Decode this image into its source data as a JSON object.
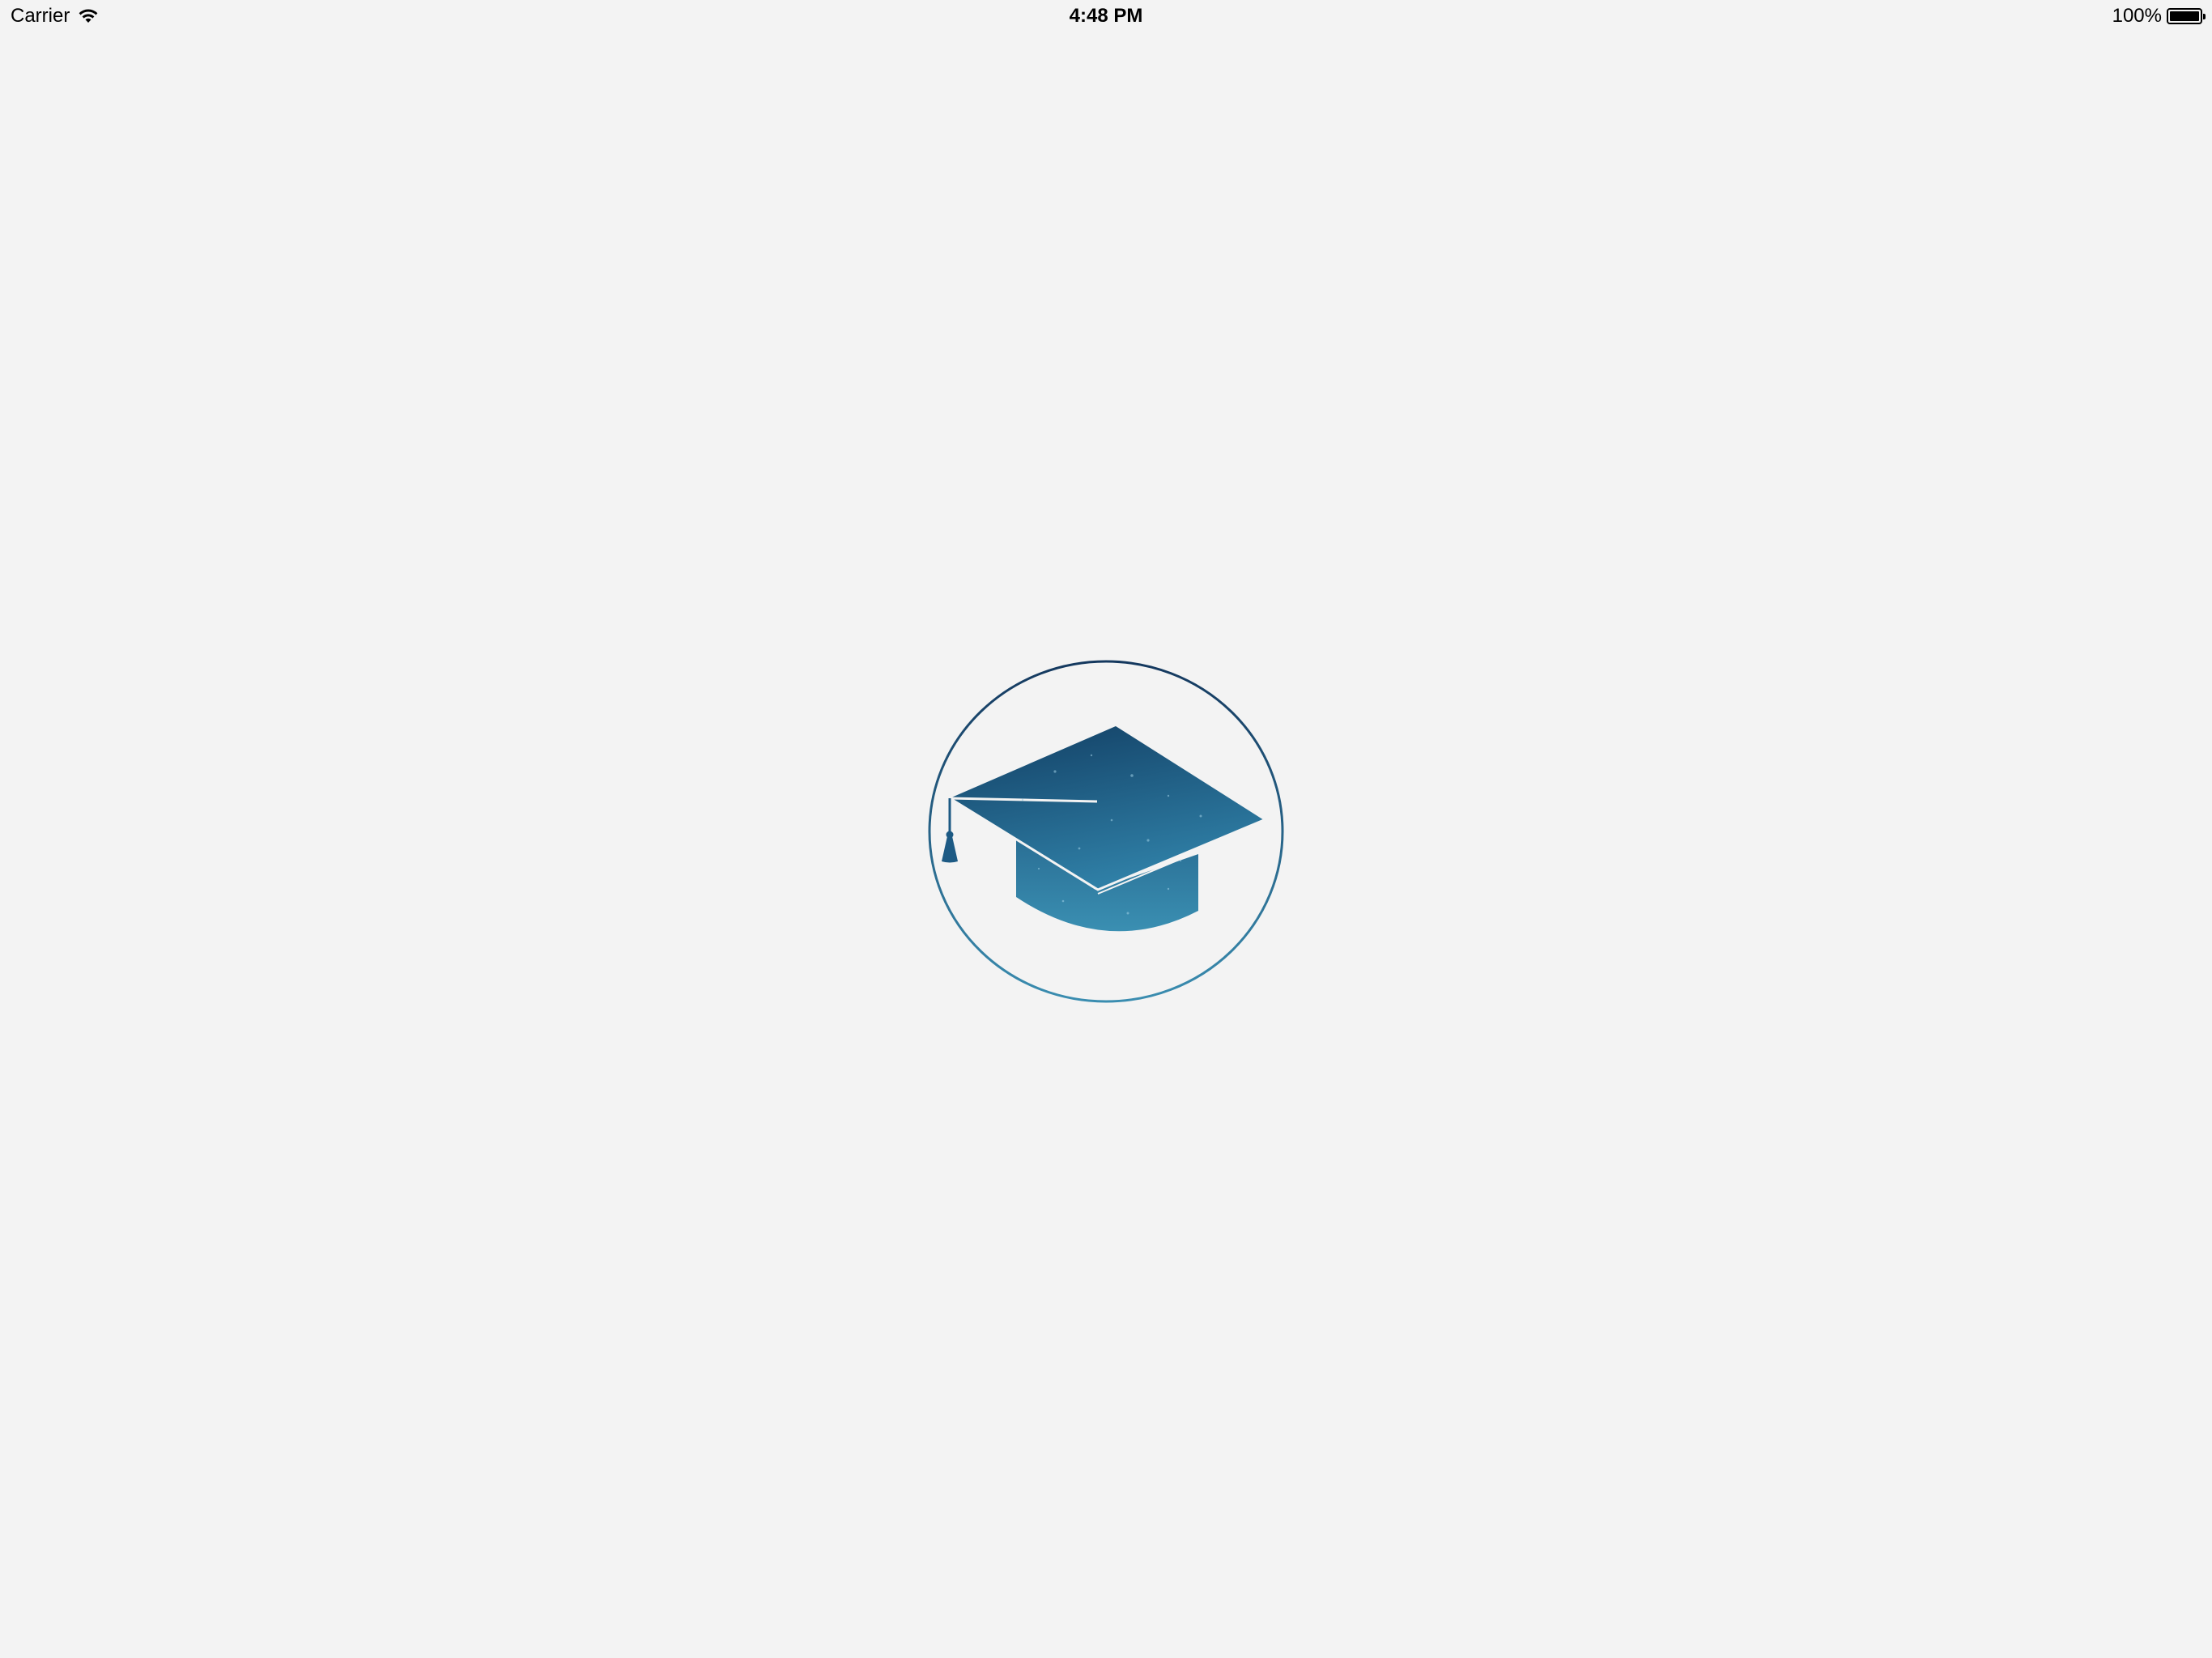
{
  "status_bar": {
    "carrier": "Carrier",
    "time": "4:48 PM",
    "battery_percent": "100%",
    "battery_level": 1.0
  },
  "splash": {
    "logo_icon": "graduation-cap-icon"
  },
  "colors": {
    "background": "#f3f3f3",
    "logo_dark": "#123f64",
    "logo_light": "#3a8db0"
  }
}
